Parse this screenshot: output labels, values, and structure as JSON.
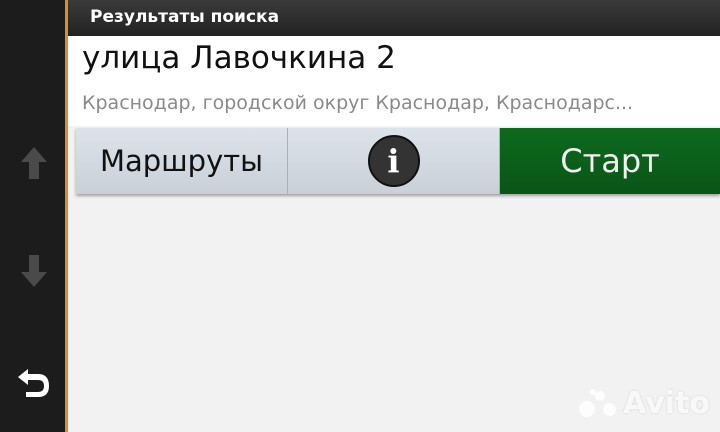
{
  "header": {
    "title": "Результаты поиска"
  },
  "result": {
    "name": "улица Лавочкина 2",
    "address": "Краснодар, городской округ Краснодар, Краснодарс..."
  },
  "actions": {
    "routes_label": "Маршруты",
    "info_glyph": "i",
    "start_label": "Старт"
  },
  "nav": {
    "up_icon": "arrow-up-icon",
    "down_icon": "arrow-down-icon",
    "back_icon": "back-arrow-icon"
  },
  "watermark": {
    "text": "Avito"
  },
  "colors": {
    "rail_accent": "#e08a2a",
    "start_green": "#0a5517",
    "action_gray": "#d3d9e0"
  }
}
